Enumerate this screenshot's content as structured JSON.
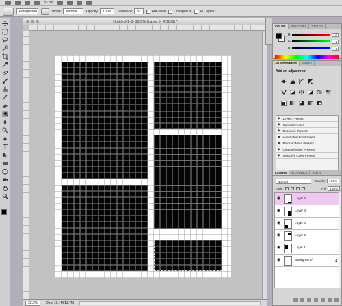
{
  "appbar": {
    "zoom": "33.3%"
  },
  "options": {
    "fill_source": "Foreground",
    "mode_label": "Mode:",
    "mode_value": "Normal",
    "opacity_label": "Opacity:",
    "opacity_value": "100%",
    "tolerance_label": "Tolerance:",
    "tolerance_value": "32",
    "antialias_label": "Anti-alias",
    "antialias_checked": true,
    "contiguous_label": "Contiguous",
    "contiguous_checked": true,
    "all_layers_label": "All Layers",
    "all_layers_checked": false
  },
  "document": {
    "title": "Untitled-1 @ 33.3% (Layer 5, RGB/8) *",
    "status_zoom": "33.3%",
    "status_doc": "Doc: 10.4M/13.7M"
  },
  "color_panel": {
    "tabs": [
      "COLOR",
      "SWATCHES",
      "STYLES"
    ],
    "channels": [
      {
        "label": "R",
        "value": "0"
      },
      {
        "label": "G",
        "value": "0"
      },
      {
        "label": "B",
        "value": "0"
      }
    ],
    "foreground": "#000000",
    "background": "#ffffff"
  },
  "adjustments_panel": {
    "tabs": [
      "ADJUSTMENTS",
      "MASKS"
    ],
    "heading": "Add an adjustment",
    "presets": [
      "Levels Presets",
      "Curves Presets",
      "Exposure Presets",
      "Hue/Saturation Presets",
      "Black & White Presets",
      "Channel Mixer Presets",
      "Selective Color Presets"
    ]
  },
  "layers_panel": {
    "tabs": [
      "LAYERS",
      "CHANNELS",
      "PATHS"
    ],
    "blend_mode": "Normal",
    "opacity_label": "Opacity:",
    "opacity_value": "100%",
    "lock_label": "Lock:",
    "fill_label": "Fill:",
    "fill_value": "100%",
    "layers": [
      {
        "name": "Layer 5",
        "active": true
      },
      {
        "name": "Layer 4",
        "active": false
      },
      {
        "name": "Layer 3",
        "active": false
      },
      {
        "name": "Layer 2",
        "active": false
      },
      {
        "name": "Layer 1",
        "active": false
      },
      {
        "name": "Background",
        "active": false,
        "locked": true
      }
    ]
  },
  "colors": {
    "canvas_panel": "#050505",
    "active_layer": "#f1c8f1",
    "workspace": "#c2c2c2"
  }
}
